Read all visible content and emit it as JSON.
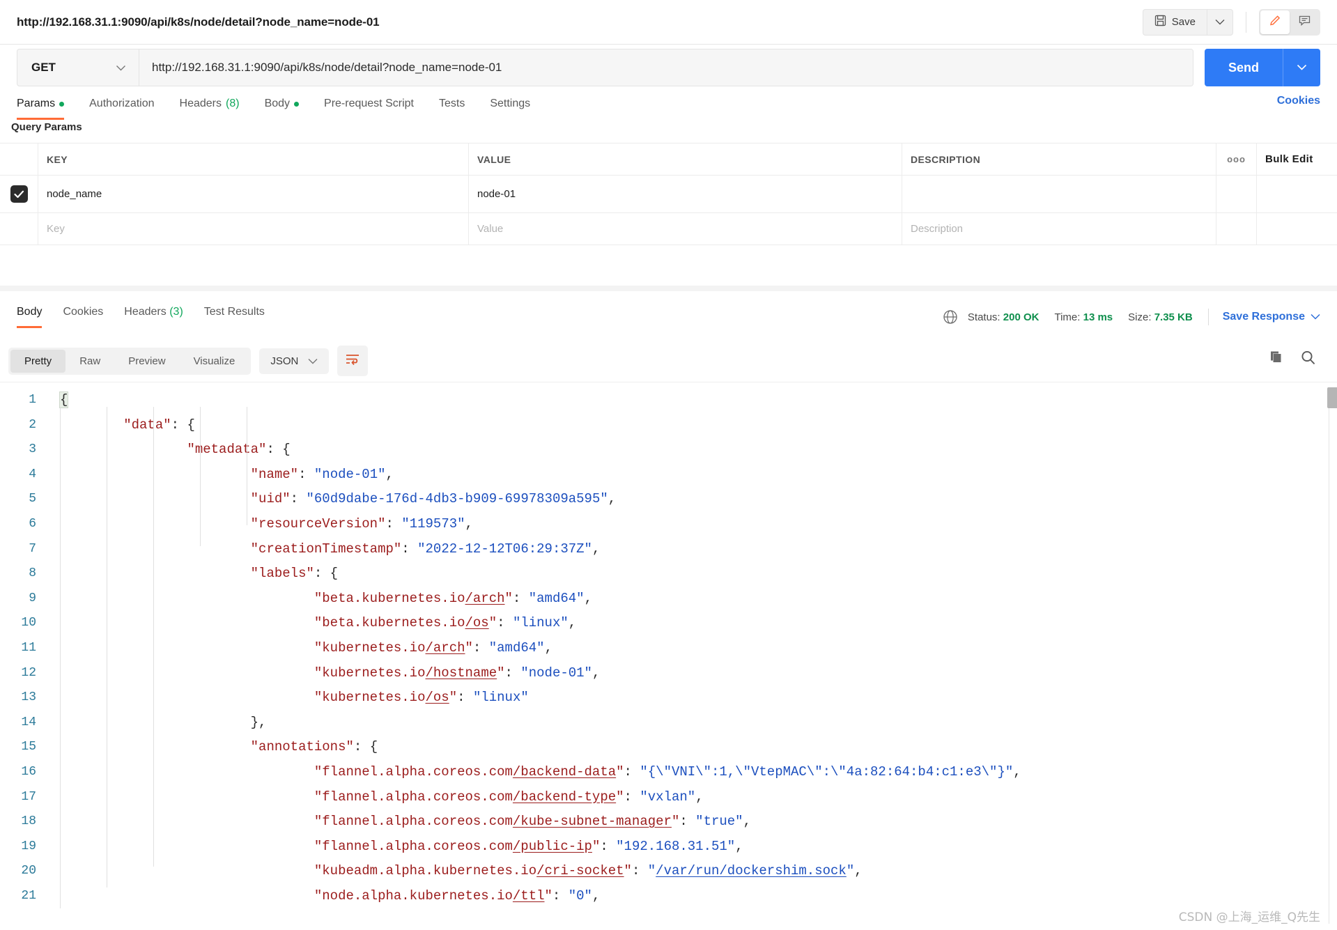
{
  "topbar": {
    "request_title": "http://192.168.31.1:9090/api/k8s/node/detail?node_name=node-01",
    "save_label": "Save",
    "save_icon": "floppy-disk-icon",
    "save_caret_icon": "chevron-down-icon",
    "edit_icon": "pencil-icon",
    "comment_icon": "comment-icon"
  },
  "request": {
    "method": "GET",
    "method_caret_icon": "chevron-down-icon",
    "url": "http://192.168.31.1:9090/api/k8s/node/detail?node_name=node-01",
    "send_label": "Send",
    "send_caret_icon": "chevron-down-icon"
  },
  "request_tabs": [
    {
      "label": "Params",
      "indicator": "dot",
      "active": true
    },
    {
      "label": "Authorization",
      "indicator": "",
      "active": false
    },
    {
      "label": "Headers",
      "count": "(8)",
      "indicator": "count",
      "active": false
    },
    {
      "label": "Body",
      "indicator": "dot",
      "active": false
    },
    {
      "label": "Pre-request Script",
      "indicator": "",
      "active": false
    },
    {
      "label": "Tests",
      "indicator": "",
      "active": false
    },
    {
      "label": "Settings",
      "indicator": "",
      "active": false
    }
  ],
  "cookies_link": "Cookies",
  "query_params": {
    "section_label": "Query Params",
    "columns": [
      "KEY",
      "VALUE",
      "DESCRIPTION"
    ],
    "options_icon": "ellipsis-icon",
    "bulk_edit_label": "Bulk Edit",
    "rows": [
      {
        "checked": true,
        "key": "node_name",
        "value": "node-01",
        "description": ""
      }
    ],
    "placeholder_row": {
      "key": "Key",
      "value": "Value",
      "description": "Description"
    }
  },
  "response_tabs": [
    {
      "label": "Body",
      "active": true
    },
    {
      "label": "Cookies",
      "active": false
    },
    {
      "label": "Headers",
      "count": "(3)",
      "active": false
    },
    {
      "label": "Test Results",
      "active": false
    }
  ],
  "response_meta": {
    "globe_icon": "globe-icon",
    "status_label": "Status:",
    "status_value": "200 OK",
    "time_label": "Time:",
    "time_value": "13 ms",
    "size_label": "Size:",
    "size_value": "7.35 KB",
    "save_response_label": "Save Response",
    "save_response_caret_icon": "chevron-down-icon"
  },
  "viewer_toolbar": {
    "modes": [
      {
        "label": "Pretty",
        "active": true
      },
      {
        "label": "Raw",
        "active": false
      },
      {
        "label": "Preview",
        "active": false
      },
      {
        "label": "Visualize",
        "active": false
      }
    ],
    "format": "JSON",
    "format_caret_icon": "chevron-down-icon",
    "wrap_icon": "word-wrap-icon",
    "copy_icon": "copy-icon",
    "search_icon": "search-icon"
  },
  "code": {
    "lines": [
      {
        "n": "1",
        "indent": 0,
        "tokens": [
          {
            "t": "{",
            "c": "p brace-hl"
          }
        ]
      },
      {
        "n": "2",
        "indent": 1,
        "tokens": [
          {
            "t": "\"data\"",
            "c": "k"
          },
          {
            "t": ": {",
            "c": "p"
          }
        ]
      },
      {
        "n": "3",
        "indent": 2,
        "tokens": [
          {
            "t": "\"metadata\"",
            "c": "k"
          },
          {
            "t": ": {",
            "c": "p"
          }
        ]
      },
      {
        "n": "4",
        "indent": 3,
        "tokens": [
          {
            "t": "\"name\"",
            "c": "k"
          },
          {
            "t": ": ",
            "c": "p"
          },
          {
            "t": "\"node-01\"",
            "c": "s"
          },
          {
            "t": ",",
            "c": "p"
          }
        ]
      },
      {
        "n": "5",
        "indent": 3,
        "tokens": [
          {
            "t": "\"uid\"",
            "c": "k"
          },
          {
            "t": ": ",
            "c": "p"
          },
          {
            "t": "\"60d9dabe-176d-4db3-b909-69978309a595\"",
            "c": "s"
          },
          {
            "t": ",",
            "c": "p"
          }
        ]
      },
      {
        "n": "6",
        "indent": 3,
        "tokens": [
          {
            "t": "\"resourceVersion\"",
            "c": "k"
          },
          {
            "t": ": ",
            "c": "p"
          },
          {
            "t": "\"119573\"",
            "c": "s"
          },
          {
            "t": ",",
            "c": "p"
          }
        ]
      },
      {
        "n": "7",
        "indent": 3,
        "tokens": [
          {
            "t": "\"creationTimestamp\"",
            "c": "k"
          },
          {
            "t": ": ",
            "c": "p"
          },
          {
            "t": "\"2022-12-12T06:29:37Z\"",
            "c": "s"
          },
          {
            "t": ",",
            "c": "p"
          }
        ]
      },
      {
        "n": "8",
        "indent": 3,
        "tokens": [
          {
            "t": "\"labels\"",
            "c": "k"
          },
          {
            "t": ": {",
            "c": "p"
          }
        ]
      },
      {
        "n": "9",
        "indent": 4,
        "tokens": [
          {
            "t": "\"beta.kubernetes.io",
            "c": "k"
          },
          {
            "t": "/arch",
            "c": "k u"
          },
          {
            "t": "\"",
            "c": "k"
          },
          {
            "t": ": ",
            "c": "p"
          },
          {
            "t": "\"amd64\"",
            "c": "s"
          },
          {
            "t": ",",
            "c": "p"
          }
        ]
      },
      {
        "n": "10",
        "indent": 4,
        "tokens": [
          {
            "t": "\"beta.kubernetes.io",
            "c": "k"
          },
          {
            "t": "/os",
            "c": "k u"
          },
          {
            "t": "\"",
            "c": "k"
          },
          {
            "t": ": ",
            "c": "p"
          },
          {
            "t": "\"linux\"",
            "c": "s"
          },
          {
            "t": ",",
            "c": "p"
          }
        ]
      },
      {
        "n": "11",
        "indent": 4,
        "tokens": [
          {
            "t": "\"kubernetes.io",
            "c": "k"
          },
          {
            "t": "/arch",
            "c": "k u"
          },
          {
            "t": "\"",
            "c": "k"
          },
          {
            "t": ": ",
            "c": "p"
          },
          {
            "t": "\"amd64\"",
            "c": "s"
          },
          {
            "t": ",",
            "c": "p"
          }
        ]
      },
      {
        "n": "12",
        "indent": 4,
        "tokens": [
          {
            "t": "\"kubernetes.io",
            "c": "k"
          },
          {
            "t": "/hostname",
            "c": "k u"
          },
          {
            "t": "\"",
            "c": "k"
          },
          {
            "t": ": ",
            "c": "p"
          },
          {
            "t": "\"node-01\"",
            "c": "s"
          },
          {
            "t": ",",
            "c": "p"
          }
        ]
      },
      {
        "n": "13",
        "indent": 4,
        "tokens": [
          {
            "t": "\"kubernetes.io",
            "c": "k"
          },
          {
            "t": "/os",
            "c": "k u"
          },
          {
            "t": "\"",
            "c": "k"
          },
          {
            "t": ": ",
            "c": "p"
          },
          {
            "t": "\"linux\"",
            "c": "s"
          }
        ]
      },
      {
        "n": "14",
        "indent": 3,
        "tokens": [
          {
            "t": "},",
            "c": "p"
          }
        ]
      },
      {
        "n": "15",
        "indent": 3,
        "tokens": [
          {
            "t": "\"annotations\"",
            "c": "k"
          },
          {
            "t": ": {",
            "c": "p"
          }
        ]
      },
      {
        "n": "16",
        "indent": 4,
        "tokens": [
          {
            "t": "\"flannel.alpha.coreos.com",
            "c": "k"
          },
          {
            "t": "/backend-data",
            "c": "k u"
          },
          {
            "t": "\"",
            "c": "k"
          },
          {
            "t": ": ",
            "c": "p"
          },
          {
            "t": "\"{\\\"VNI\\\":1,\\\"VtepMAC\\\":\\\"4a:82:64:b4:c1:e3\\\"}\"",
            "c": "s"
          },
          {
            "t": ",",
            "c": "p"
          }
        ]
      },
      {
        "n": "17",
        "indent": 4,
        "tokens": [
          {
            "t": "\"flannel.alpha.coreos.com",
            "c": "k"
          },
          {
            "t": "/backend-type",
            "c": "k u"
          },
          {
            "t": "\"",
            "c": "k"
          },
          {
            "t": ": ",
            "c": "p"
          },
          {
            "t": "\"vxlan\"",
            "c": "s"
          },
          {
            "t": ",",
            "c": "p"
          }
        ]
      },
      {
        "n": "18",
        "indent": 4,
        "tokens": [
          {
            "t": "\"flannel.alpha.coreos.com",
            "c": "k"
          },
          {
            "t": "/kube-subnet-manager",
            "c": "k u"
          },
          {
            "t": "\"",
            "c": "k"
          },
          {
            "t": ": ",
            "c": "p"
          },
          {
            "t": "\"true\"",
            "c": "s"
          },
          {
            "t": ",",
            "c": "p"
          }
        ]
      },
      {
        "n": "19",
        "indent": 4,
        "tokens": [
          {
            "t": "\"flannel.alpha.coreos.com",
            "c": "k"
          },
          {
            "t": "/public-ip",
            "c": "k u"
          },
          {
            "t": "\"",
            "c": "k"
          },
          {
            "t": ": ",
            "c": "p"
          },
          {
            "t": "\"192.168.31.51\"",
            "c": "s"
          },
          {
            "t": ",",
            "c": "p"
          }
        ]
      },
      {
        "n": "20",
        "indent": 4,
        "tokens": [
          {
            "t": "\"kubeadm.alpha.kubernetes.io",
            "c": "k"
          },
          {
            "t": "/cri-socket",
            "c": "k u"
          },
          {
            "t": "\"",
            "c": "k"
          },
          {
            "t": ": ",
            "c": "p"
          },
          {
            "t": "\"",
            "c": "s"
          },
          {
            "t": "/var/run/dockershim.sock",
            "c": "s u"
          },
          {
            "t": "\"",
            "c": "s"
          },
          {
            "t": ",",
            "c": "p"
          }
        ]
      },
      {
        "n": "21",
        "indent": 4,
        "tokens": [
          {
            "t": "\"node.alpha.kubernetes.io",
            "c": "k"
          },
          {
            "t": "/ttl",
            "c": "k u"
          },
          {
            "t": "\"",
            "c": "k"
          },
          {
            "t": ": ",
            "c": "p"
          },
          {
            "t": "\"0\"",
            "c": "s"
          },
          {
            "t": ",",
            "c": "p"
          }
        ]
      }
    ]
  },
  "watermark": "CSDN @上海_运维_Q先生",
  "colors": {
    "accent_orange": "#ff6c37",
    "send_blue": "#2e7bf6",
    "link_blue": "#2e6fd9",
    "success_green": "#0f8f4d",
    "json_key": "#9b1c1c",
    "json_string": "#1c4fbe",
    "line_number": "#2b7a99"
  }
}
